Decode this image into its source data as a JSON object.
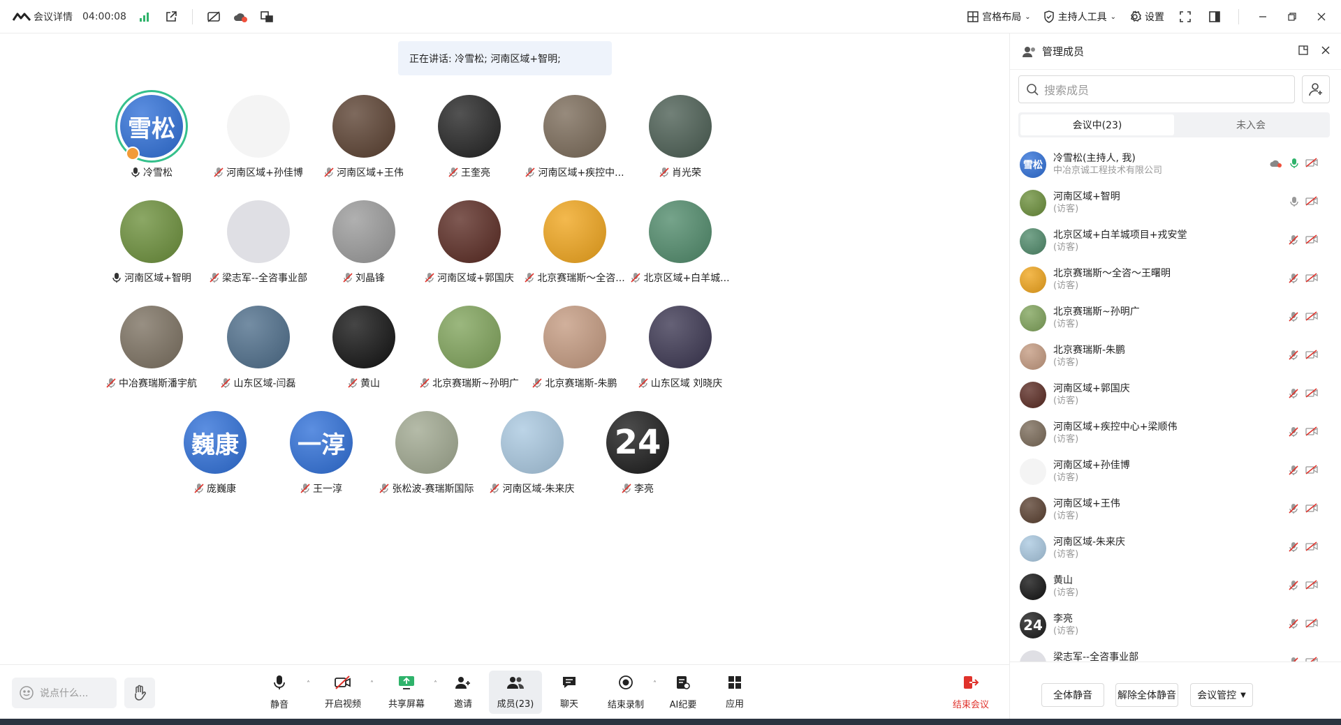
{
  "topbar": {
    "meeting_details": "会议详情",
    "timer": "04:00:08",
    "grid_layout": "宫格布局",
    "host_tools": "主持人工具",
    "settings": "设置"
  },
  "stage": {
    "speaking": "正在讲话: 冷雪松; 河南区域+智明;"
  },
  "participants": [
    {
      "name": "冷雪松",
      "avatar_text": "雪松",
      "color": "#2e6fd8",
      "mic": "on",
      "host": true
    },
    {
      "name": "河南区域+孙佳博",
      "avatar_text": "",
      "color": "#f4f4f4",
      "mic": "off"
    },
    {
      "name": "河南区域+王伟",
      "avatar_text": "",
      "color": "#5a4030",
      "mic": "off"
    },
    {
      "name": "王奎亮",
      "avatar_text": "",
      "color": "#222222",
      "mic": "off"
    },
    {
      "name": "河南区域+疾控中...",
      "avatar_text": "",
      "color": "#7a6a58",
      "mic": "off"
    },
    {
      "name": "肖光荣",
      "avatar_text": "",
      "color": "#4a5d52",
      "mic": "off"
    },
    {
      "name": "河南区域+智明",
      "avatar_text": "",
      "color": "#6b8f3a",
      "mic": "on"
    },
    {
      "name": "梁志军--全咨事业部",
      "avatar_text": "",
      "color": "#dfdfe4",
      "mic": "off"
    },
    {
      "name": "刘晶锋",
      "avatar_text": "",
      "color": "#9a9a9a",
      "mic": "off"
    },
    {
      "name": "河南区域+郭国庆",
      "avatar_text": "",
      "color": "#5a2a22",
      "mic": "off"
    },
    {
      "name": "北京赛瑞斯～全咨...",
      "avatar_text": "",
      "color": "#f0a51c",
      "mic": "off"
    },
    {
      "name": "北京区域+白羊城...",
      "avatar_text": "",
      "color": "#4f8a6a",
      "mic": "off"
    },
    {
      "name": "中冶赛瑞斯潘宇航",
      "avatar_text": "",
      "color": "#7b7060",
      "mic": "off"
    },
    {
      "name": "山东区域-闫磊",
      "avatar_text": "",
      "color": "#4d6d8a",
      "mic": "off"
    },
    {
      "name": "黄山",
      "avatar_text": "",
      "color": "#111111",
      "mic": "off"
    },
    {
      "name": "北京赛瑞斯~孙明广",
      "avatar_text": "",
      "color": "#7fa35a",
      "mic": "off"
    },
    {
      "name": "北京赛瑞斯-朱鹏",
      "avatar_text": "",
      "color": "#c49a80",
      "mic": "off"
    },
    {
      "name": "山东区域 刘晓庆",
      "avatar_text": "",
      "color": "#3a3550",
      "mic": "off"
    },
    {
      "name": "庞巍康",
      "avatar_text": "巍康",
      "color": "#2e6fd8",
      "mic": "off"
    },
    {
      "name": "王一淳",
      "avatar_text": "一淳",
      "color": "#2e6fd8",
      "mic": "off"
    },
    {
      "name": "张松波-赛瑞斯国际",
      "avatar_text": "",
      "color": "#a0a890",
      "mic": "off"
    },
    {
      "name": "河南区域-朱来庆",
      "avatar_text": "",
      "color": "#a9c8e0",
      "mic": "off"
    },
    {
      "name": "李亮",
      "avatar_text": "24",
      "color": "#1a1a1a",
      "mic": "off"
    }
  ],
  "bottombar": {
    "say_placeholder": "说点什么...",
    "tools": [
      {
        "label": "静音",
        "icon": "mic-icon"
      },
      {
        "label": "开启视频",
        "icon": "video-off-icon"
      },
      {
        "label": "共享屏幕",
        "icon": "share-screen-icon"
      },
      {
        "label": "邀请",
        "icon": "invite-icon"
      },
      {
        "label": "成员(23)",
        "icon": "members-icon"
      },
      {
        "label": "聊天",
        "icon": "chat-icon"
      },
      {
        "label": "结束录制",
        "icon": "record-stop-icon"
      },
      {
        "label": "AI纪要",
        "icon": "ai-notes-icon"
      },
      {
        "label": "应用",
        "icon": "apps-icon"
      }
    ],
    "end_meeting": "结束会议"
  },
  "panel": {
    "title": "管理成员",
    "search_placeholder": "搜索成员",
    "tab_in_meeting": "会议中(23)",
    "tab_not_joined": "未入会",
    "members": [
      {
        "name": "冷雪松(主持人, 我)",
        "sub": "中冶京诚工程技术有限公司",
        "avatar_text": "雪松",
        "color": "#2e6fd8",
        "mic": "on"
      },
      {
        "name": "河南区域+智明",
        "sub": "(访客)",
        "avatar_text": "",
        "color": "#6b8f3a",
        "mic": "idle"
      },
      {
        "name": "北京区域+白羊城项目+戎安堂",
        "sub": "(访客)",
        "avatar_text": "",
        "color": "#4f8a6a",
        "mic": "off"
      },
      {
        "name": "北京赛瑞斯～全咨～王曙明",
        "sub": "(访客)",
        "avatar_text": "",
        "color": "#f0a51c",
        "mic": "off"
      },
      {
        "name": "北京赛瑞斯~孙明广",
        "sub": "(访客)",
        "avatar_text": "",
        "color": "#7fa35a",
        "mic": "off"
      },
      {
        "name": "北京赛瑞斯-朱鹏",
        "sub": "(访客)",
        "avatar_text": "",
        "color": "#c49a80",
        "mic": "off"
      },
      {
        "name": "河南区域+郭国庆",
        "sub": "(访客)",
        "avatar_text": "",
        "color": "#5a2a22",
        "mic": "off"
      },
      {
        "name": "河南区域+疾控中心+梁顺伟",
        "sub": "(访客)",
        "avatar_text": "",
        "color": "#7a6a58",
        "mic": "off"
      },
      {
        "name": "河南区域+孙佳博",
        "sub": "(访客)",
        "avatar_text": "",
        "color": "#f4f4f4",
        "mic": "off"
      },
      {
        "name": "河南区域+王伟",
        "sub": "(访客)",
        "avatar_text": "",
        "color": "#5a4030",
        "mic": "off"
      },
      {
        "name": "河南区域-朱来庆",
        "sub": "(访客)",
        "avatar_text": "",
        "color": "#a9c8e0",
        "mic": "off"
      },
      {
        "name": "黄山",
        "sub": "(访客)",
        "avatar_text": "",
        "color": "#111111",
        "mic": "off"
      },
      {
        "name": "李亮",
        "sub": "(访客)",
        "avatar_text": "24",
        "color": "#1a1a1a",
        "mic": "off"
      },
      {
        "name": "梁志军--全咨事业部",
        "sub": "(访客)",
        "avatar_text": "",
        "color": "#dfdfe4",
        "mic": "off"
      }
    ],
    "mute_all": "全体静音",
    "unmute_all": "解除全体静音",
    "meeting_control": "会议管控"
  }
}
